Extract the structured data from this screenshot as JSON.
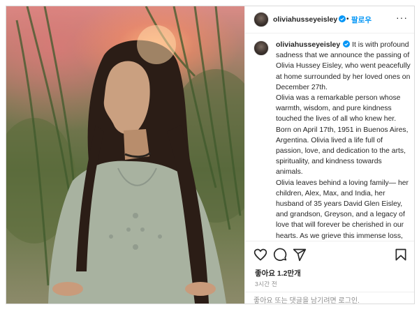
{
  "post": {
    "username": "oliviahusseyeisley",
    "follow_label": "팔로우",
    "dot": "•",
    "more": "···",
    "caption": {
      "username": "oliviahusseyeisley",
      "para1": "It is with profound sadness that we announce the passing of Olivia Hussey Eisley, who went peacefully at home surrounded by her loved ones on December 27th.",
      "para2": "Olivia was a remarkable person whose warmth, wisdom, and pure kindness touched the lives of all who knew her. Born on April 17th, 1951 in Buenos Aires, Argentina. Olivia lived a life full of passion, love, and dedication to the arts, spirituality, and kindness towards animals.",
      "para3": "Olivia leaves behind a loving family— her children, Alex, Max, and India, her husband of 35 years David Glen Eisley, and grandson, Greyson, and a legacy of love that will forever be cherished in our hearts. As we grieve this immense loss, we also celebrate Olivia's enduring impact on our lives."
    },
    "likes": "좋아요 1.2만개",
    "time": "3시간 전",
    "login_prompt": "좋아요 또는 댓글을 남기려면 로그인."
  },
  "icons": {
    "verified": "verified-badge-icon",
    "like": "heart-icon",
    "comment": "comment-icon",
    "share": "paper-plane-icon",
    "save": "bookmark-icon"
  },
  "colors": {
    "accent": "#0095f6",
    "text": "#262626",
    "muted": "#8e8e8e",
    "border": "#dbdbdb"
  }
}
